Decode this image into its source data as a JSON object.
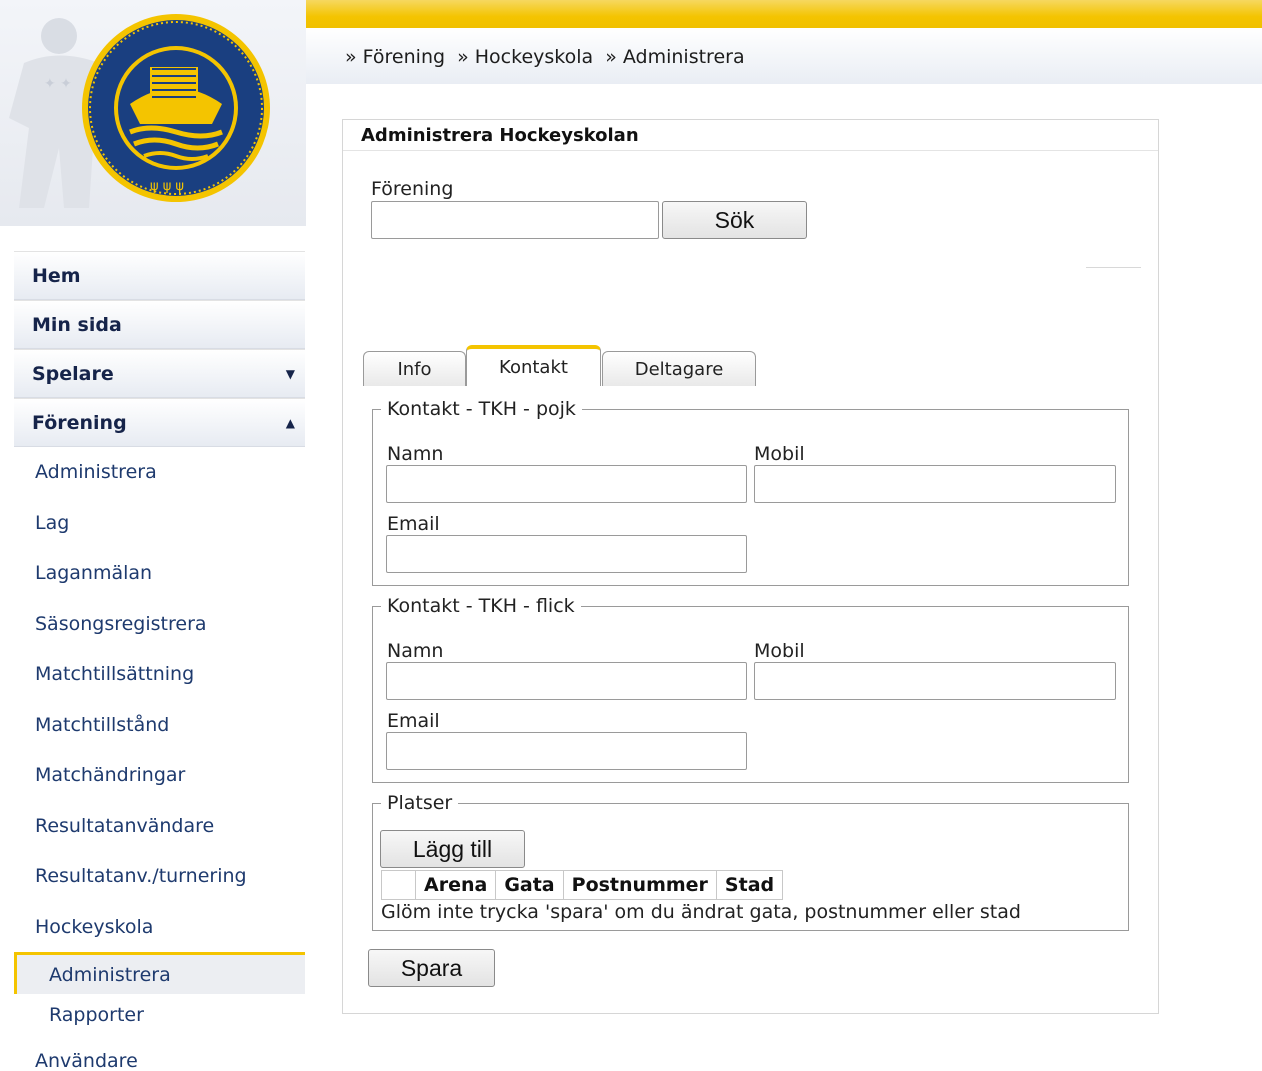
{
  "breadcrumb": [
    "» Förening",
    "» Hockeyskola",
    "» Administrera"
  ],
  "nav": {
    "main": [
      {
        "label": "Hem"
      },
      {
        "label": "Min sida"
      },
      {
        "label": "Spelare",
        "arrow": "▼"
      },
      {
        "label": "Förening",
        "arrow": "▲"
      }
    ],
    "sub": [
      "Administrera",
      "Lag",
      "Laganmälan",
      "Säsongsregistrera",
      "Matchtillsättning",
      "Matchtillstånd",
      "Matchändringar",
      "Resultatanvändare",
      "Resultatanv./turnering",
      "Hockeyskola"
    ],
    "subsub": [
      "Administrera",
      "Rapporter"
    ],
    "last": "Användare"
  },
  "panel": {
    "title": "Administrera Hockeyskolan",
    "forening_label": "Förening",
    "search_button": "Sök",
    "tabs": [
      "Info",
      "Kontakt",
      "Deltagare"
    ],
    "active_tab": "Kontakt"
  },
  "contact_boy": {
    "legend": "Kontakt - TKH - pojk",
    "name_label": "Namn",
    "mobile_label": "Mobil",
    "email_label": "Email"
  },
  "contact_girl": {
    "legend": "Kontakt - TKH - flick",
    "name_label": "Namn",
    "mobile_label": "Mobil",
    "email_label": "Email"
  },
  "places": {
    "legend": "Platser",
    "add_button": "Lägg till",
    "columns": [
      "",
      "Arena",
      "Gata",
      "Postnummer",
      "Stad"
    ],
    "note": "Glöm inte trycka 'spara' om du ändrat gata, postnummer eller stad"
  },
  "save_button": "Spara",
  "colors": {
    "accent": "#f4c400",
    "nav_text": "#16244a",
    "link": "#1e3a6e"
  },
  "icons": [
    "federation-logo",
    "player-silhouette",
    "chevron-down-icon",
    "chevron-up-icon"
  ]
}
